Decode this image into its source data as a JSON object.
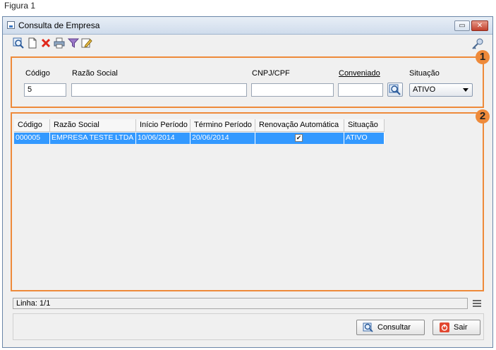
{
  "figure_label": "Figura 1",
  "window": {
    "title": "Consulta de Empresa",
    "restore_glyph": "▭",
    "close_glyph": "✕"
  },
  "toolbar": {
    "icons": [
      "search-icon",
      "new-document-icon",
      "delete-icon",
      "print-icon",
      "filter-icon",
      "edit-icon"
    ],
    "right_icon": "key-icon"
  },
  "badges": {
    "one": "1",
    "two": "2"
  },
  "filters": {
    "codigo_label": "Código",
    "codigo_value": "5",
    "razao_label": "Razão Social",
    "razao_value": "",
    "cnpj_label": "CNPJ/CPF",
    "cnpj_value": "",
    "conveniado_label": "Conveniado",
    "conveniado_value": "",
    "situacao_label": "Situação",
    "situacao_value": "ATIVO"
  },
  "table": {
    "headers": [
      "Código",
      "Razão Social",
      "Início Período",
      "Término Período",
      "Renovação Automática",
      "Situação"
    ],
    "rows": [
      {
        "codigo": "000005",
        "razao": "EMPRESA TESTE LTDA",
        "inicio": "10/06/2014",
        "termino": "20/06/2014",
        "renovacao": true,
        "situacao": "ATIVO"
      }
    ],
    "check_glyph": "✔"
  },
  "status": {
    "linha": "Linha: 1/1"
  },
  "buttons": {
    "consultar": "Consultar",
    "sair": "Sair"
  },
  "colors": {
    "accent_orange": "#ee8a3a",
    "selection_blue": "#3399ff"
  }
}
